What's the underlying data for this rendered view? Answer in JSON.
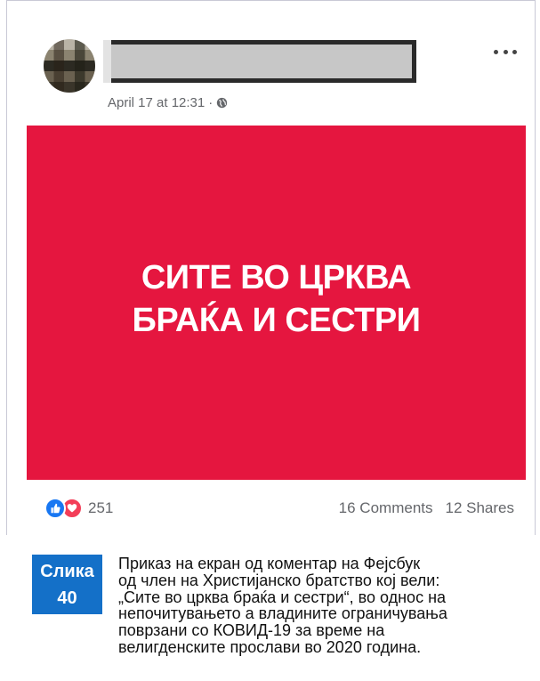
{
  "post": {
    "timestamp": "April 17 at 12:31",
    "separator": "·",
    "privacy_icon": "globe-icon",
    "more_icon": "ellipsis-icon",
    "image_text_line1": "СИТЕ ВО ЦРКВА",
    "image_text_line2": "БРАЌА И СЕСТРИ",
    "image_bg_color": "#e5163f"
  },
  "engagement": {
    "reaction_count": "251",
    "comments": "16 Comments",
    "shares": "12 Shares"
  },
  "caption": {
    "label_line1": "Слика",
    "label_line2": "40",
    "line1": "Приказ на екран од коментар на Фејсбук",
    "line2": "од член на Христијанско братство кој вели:",
    "line3": "„Сите во црква браќа и сестри“, во однос на",
    "line4": "непочитувањето а владините ограничувања",
    "line5": "поврзани со КОВИД-19 за време на",
    "line6": "велигденските прослави во 2020 година.",
    "accent_color": "#1470c8"
  }
}
